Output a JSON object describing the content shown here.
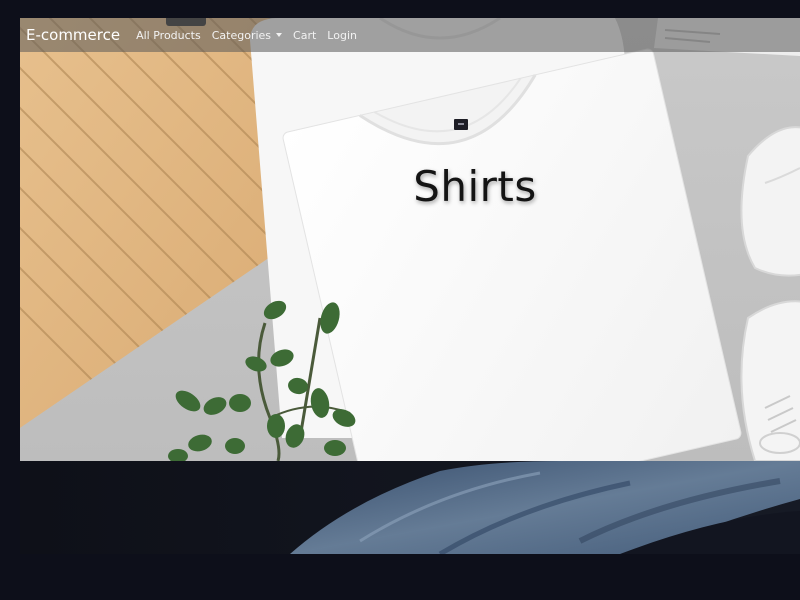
{
  "navbar": {
    "brand": "E-commerce",
    "links": {
      "all_products": "All Products",
      "categories": "Categories",
      "cart": "Cart",
      "login": "Login"
    }
  },
  "hero": {
    "title": "Shirts",
    "image": "white-tshirt-flatlay",
    "tag_icon": "shirt-label-icon"
  },
  "banner2": {
    "image": "denim-jeans"
  },
  "colors": {
    "page_background": "#0d0f1a",
    "navbar_overlay": "rgba(90,90,90,0.55)",
    "hero_title": "#141414",
    "nav_text": "#f2f2f2"
  }
}
